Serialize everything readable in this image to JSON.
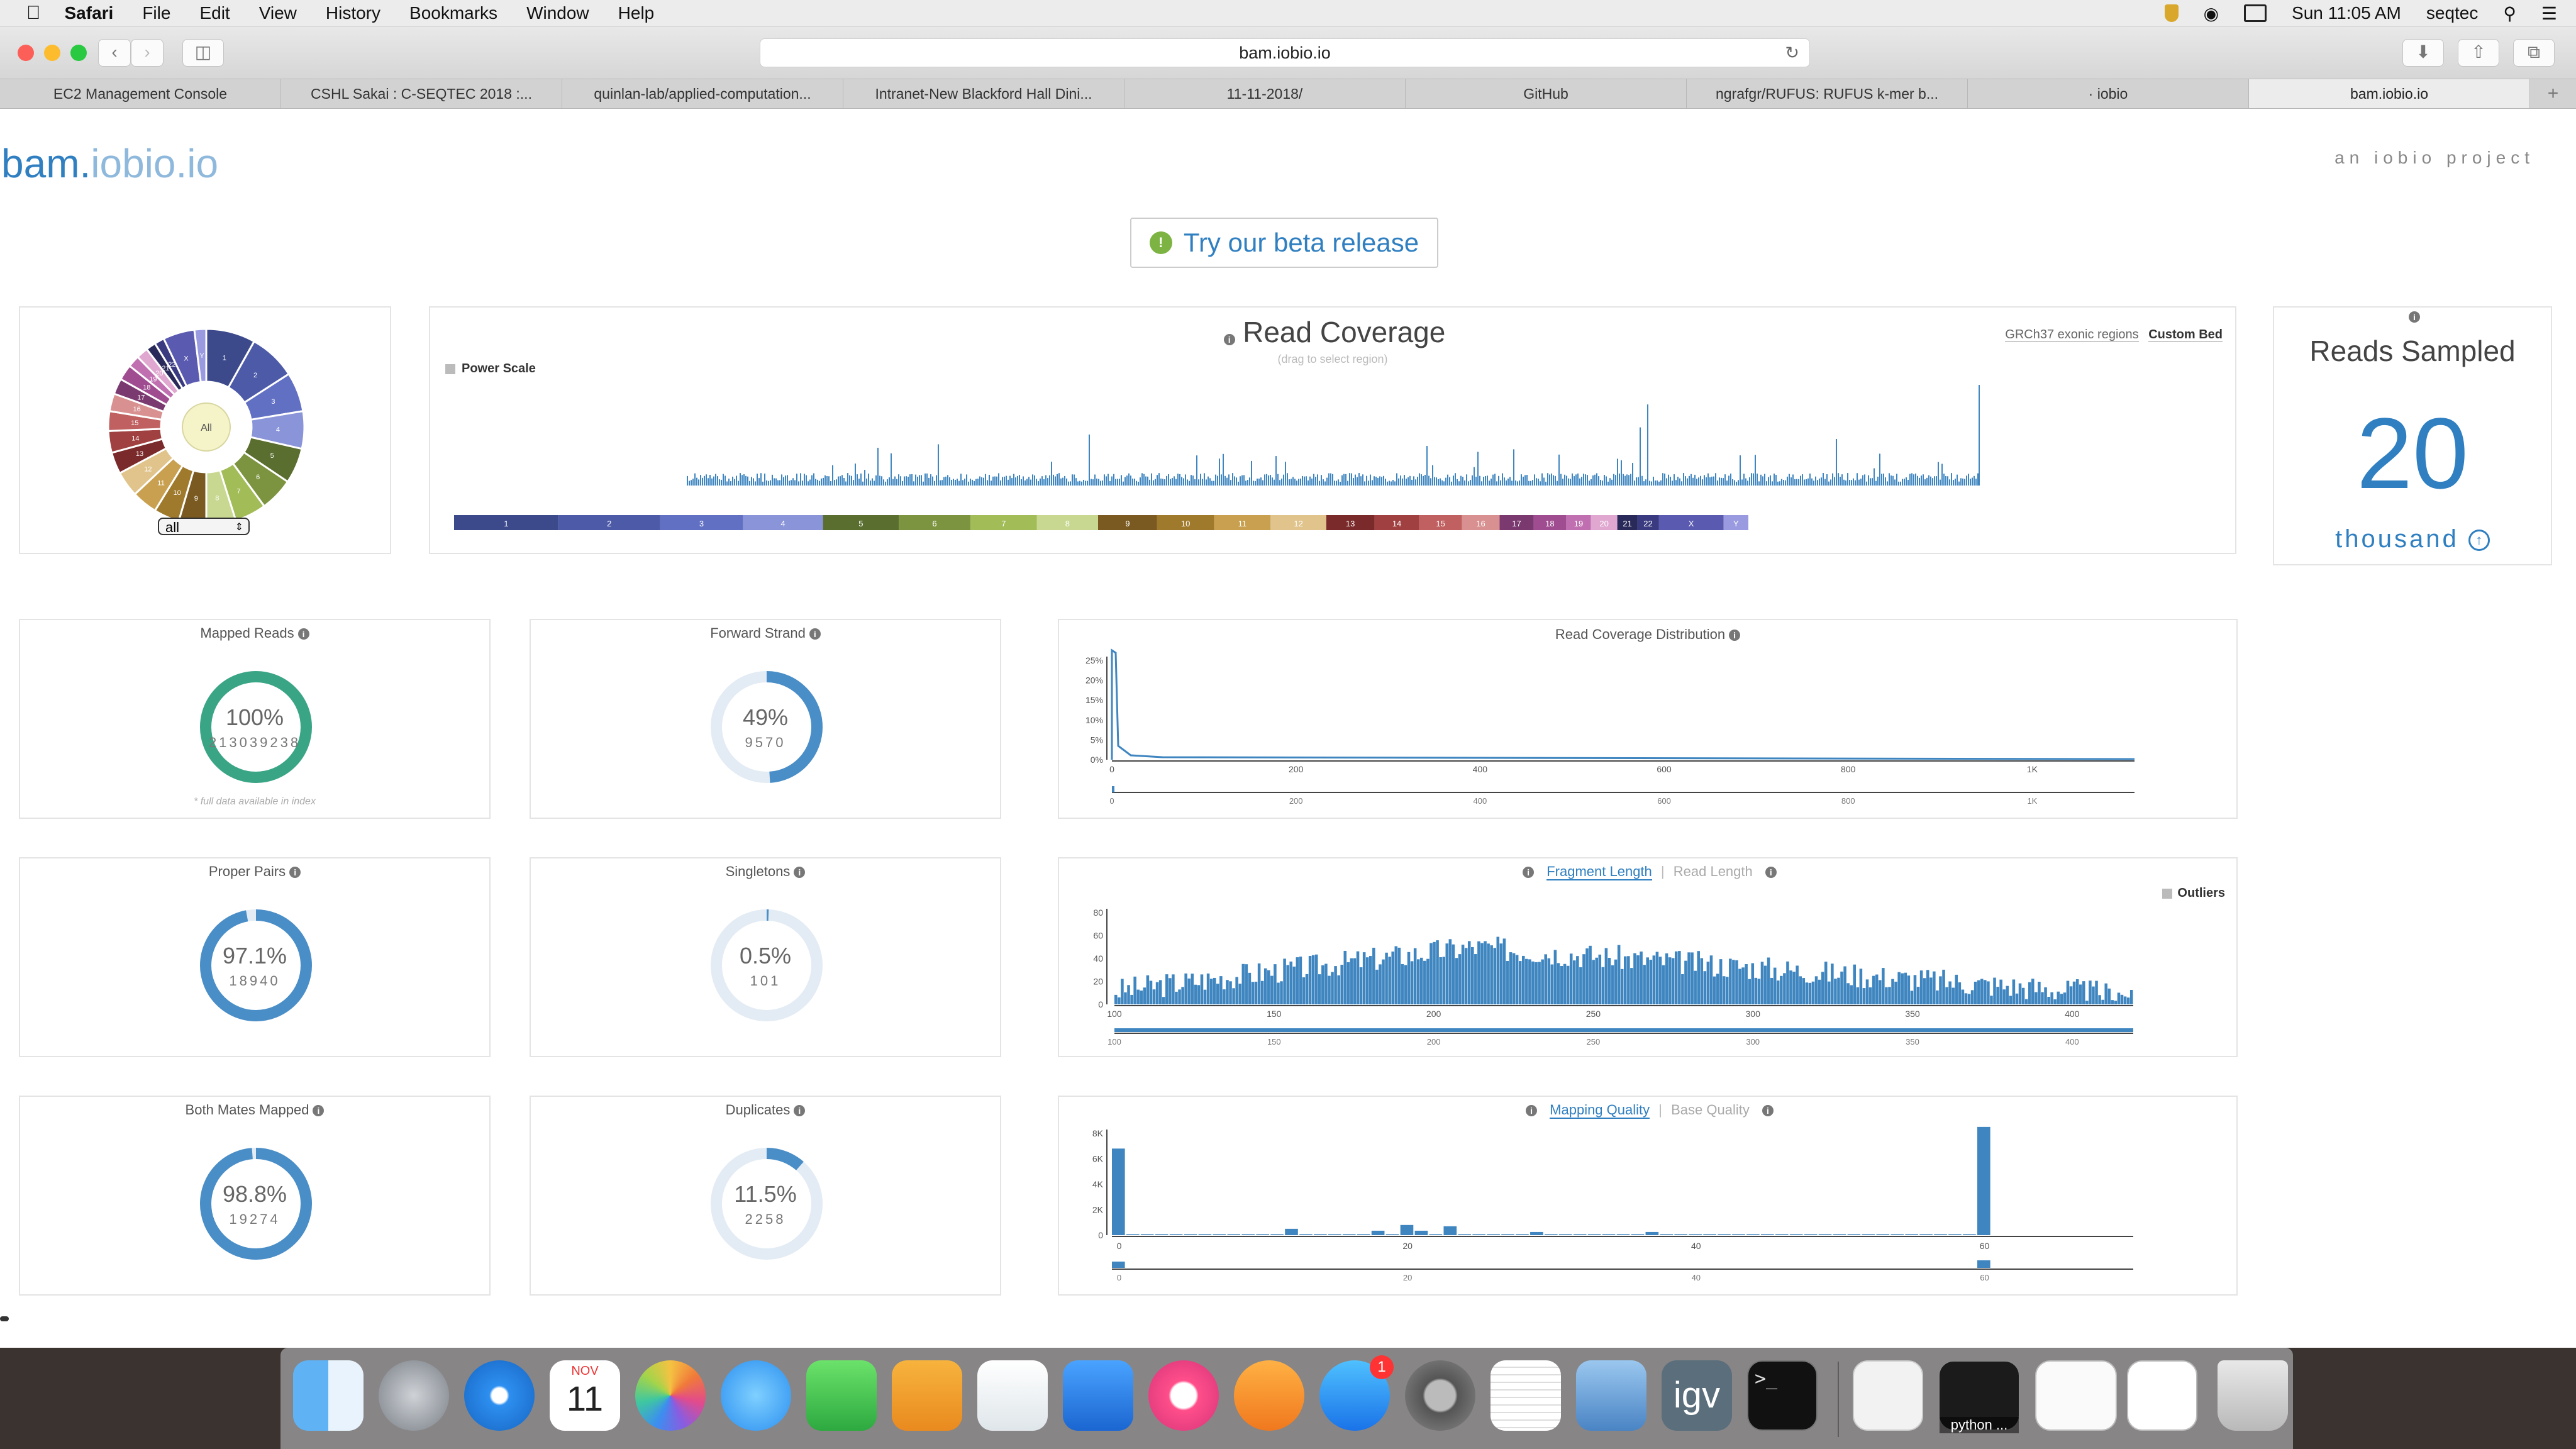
{
  "menubar": {
    "app": "Safari",
    "items": [
      "File",
      "Edit",
      "View",
      "History",
      "Bookmarks",
      "Window",
      "Help"
    ],
    "clock": "Sun 11:05 AM",
    "user": "seqtec"
  },
  "browser": {
    "url": "bam.iobio.io",
    "tabs": [
      {
        "label": "EC2 Management Console"
      },
      {
        "label": "CSHL Sakai : C-SEQTEC 2018 :..."
      },
      {
        "label": "quinlan-lab/applied-computation..."
      },
      {
        "label": "Intranet-New Blackford Hall Dini..."
      },
      {
        "label": "11-11-2018/"
      },
      {
        "label": "GitHub"
      },
      {
        "label": "ngrafgr/RUFUS: RUFUS k-mer b..."
      },
      {
        "label": "· iobio"
      },
      {
        "label": "bam.iobio.io"
      }
    ]
  },
  "page": {
    "logo_main": "bam.",
    "logo_sub": "iobio.io",
    "tagline": "an iobio project",
    "beta_button": "Try our beta release",
    "chrom_select": "all",
    "wheel_center": "All"
  },
  "coverage": {
    "title": "Read Coverage",
    "subtitle": "(drag to select region)",
    "power_scale": "Power Scale",
    "link_exonic": "GRCh37 exonic regions",
    "link_custom": "Custom Bed",
    "chromosomes": [
      "1",
      "2",
      "3",
      "4",
      "5",
      "6",
      "7",
      "8",
      "9",
      "10",
      "11",
      "12",
      "13",
      "14",
      "15",
      "16",
      "17",
      "18",
      "19",
      "20",
      "21",
      "22",
      "X",
      "Y"
    ]
  },
  "reads_sampled": {
    "title": "Reads Sampled",
    "value": "20",
    "unit": "thousand"
  },
  "stats": [
    {
      "title": "Mapped Reads",
      "pct": "100%",
      "count": "213039238",
      "note": "* full data available in index",
      "fraction": 1.0
    },
    {
      "title": "Forward Strand",
      "pct": "49%",
      "count": "9570",
      "fraction": 0.49
    },
    {
      "title": "Proper Pairs",
      "pct": "97.1%",
      "count": "18940",
      "fraction": 0.971
    },
    {
      "title": "Singletons",
      "pct": "0.5%",
      "count": "101",
      "fraction": 0.005
    },
    {
      "title": "Both Mates Mapped",
      "pct": "98.8%",
      "count": "19274",
      "fraction": 0.988
    },
    {
      "title": "Duplicates",
      "pct": "11.5%",
      "count": "2258",
      "fraction": 0.115
    }
  ],
  "coverage_dist": {
    "title": "Read Coverage Distribution",
    "yticks": [
      "25%",
      "20%",
      "15%",
      "10%",
      "5%",
      "0%"
    ],
    "xticks": [
      "0",
      "200",
      "400",
      "600",
      "800",
      "1K"
    ]
  },
  "fragment": {
    "tab_active": "Fragment Length",
    "tab_inactive": "Read Length",
    "outliers": "Outliers",
    "yticks": [
      "80",
      "60",
      "40",
      "20",
      "0"
    ],
    "xticks": [
      "100",
      "150",
      "200",
      "250",
      "300",
      "350",
      "400"
    ]
  },
  "mapq": {
    "tab_active": "Mapping Quality",
    "tab_inactive": "Base Quality",
    "yticks": [
      "8K",
      "6K",
      "4K",
      "2K",
      "0"
    ],
    "xticks": [
      "0",
      "20",
      "40",
      "60"
    ]
  },
  "dock": {
    "calendar_month": "NOV",
    "calendar_day": "11",
    "badge": "1",
    "igv": "igv",
    "python": "python ..."
  },
  "colors": {
    "accent": "#2f7fc1",
    "bar": "#3f86c0",
    "donut_green": "#3aa585",
    "donut_blue": "#4a8ec7",
    "track": "#e3ecf4"
  }
}
